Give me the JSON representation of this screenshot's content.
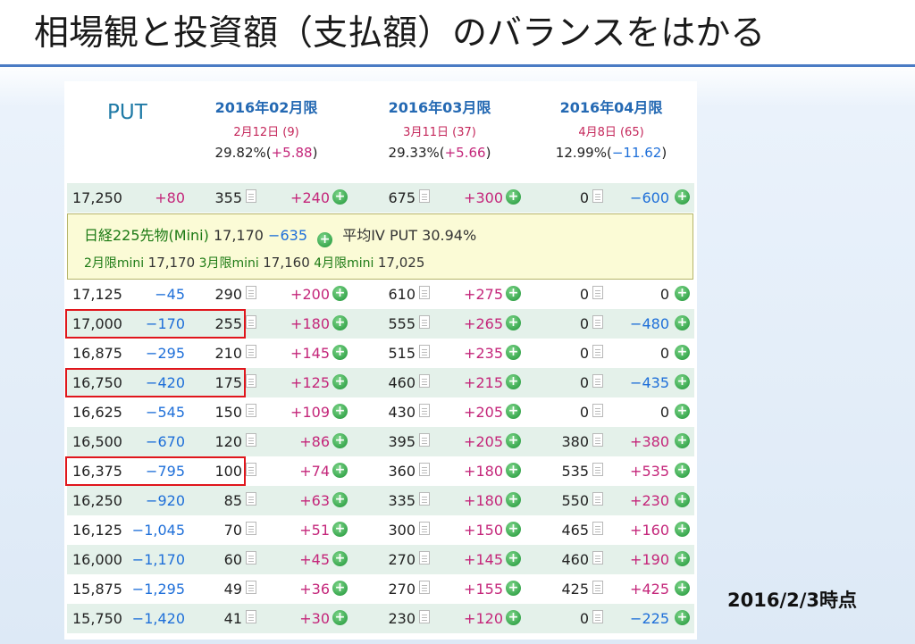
{
  "slide": {
    "title": "相場観と投資額（支払額）のバランスをはかる",
    "timestamp": "2016/2/3時点"
  },
  "table": {
    "header": {
      "put_label": "PUT",
      "months": [
        {
          "contract": "2016年02月限",
          "expiry": "2月12日 (9)",
          "iv": "29.82%",
          "iv_change": "+5.88",
          "iv_change_dir": "up"
        },
        {
          "contract": "2016年03月限",
          "expiry": "3月11日 (37)",
          "iv": "29.33%",
          "iv_change": "+5.66",
          "iv_change_dir": "up"
        },
        {
          "contract": "2016年04月限",
          "expiry": "4月8日 (65)",
          "iv": "12.99%",
          "iv_change": "−11.62",
          "iv_change_dir": "down"
        }
      ]
    },
    "info": {
      "futures_label": "日経225先物(Mini)",
      "futures_price": "17,170",
      "futures_change": "−635",
      "avg_iv_label": "平均IV PUT",
      "avg_iv_value": "30.94%",
      "mini1_label": "2月限mini",
      "mini1_price": "17,170",
      "mini2_label": "3月限mini",
      "mini2_price": "17,160",
      "mini3_label": "4月限mini",
      "mini3_price": "17,025"
    },
    "rows": [
      {
        "strike": "17,250",
        "chg": "+80",
        "chg_dir": "up",
        "p1": "355",
        "c1": "+240",
        "c1_dir": "up",
        "p2": "675",
        "c2": "+300",
        "c2_dir": "up",
        "p3": "0",
        "c3": "−600",
        "c3_dir": "down"
      },
      {
        "strike": "17,125",
        "chg": "−45",
        "chg_dir": "down",
        "p1": "290",
        "c1": "+200",
        "c1_dir": "up",
        "p2": "610",
        "c2": "+275",
        "c2_dir": "up",
        "p3": "0",
        "c3": "0",
        "c3_dir": "zero"
      },
      {
        "strike": "17,000",
        "chg": "−170",
        "chg_dir": "down",
        "p1": "255",
        "c1": "+180",
        "c1_dir": "up",
        "p2": "555",
        "c2": "+265",
        "c2_dir": "up",
        "p3": "0",
        "c3": "−480",
        "c3_dir": "down",
        "highlight": true
      },
      {
        "strike": "16,875",
        "chg": "−295",
        "chg_dir": "down",
        "p1": "210",
        "c1": "+145",
        "c1_dir": "up",
        "p2": "515",
        "c2": "+235",
        "c2_dir": "up",
        "p3": "0",
        "c3": "0",
        "c3_dir": "zero"
      },
      {
        "strike": "16,750",
        "chg": "−420",
        "chg_dir": "down",
        "p1": "175",
        "c1": "+125",
        "c1_dir": "up",
        "p2": "460",
        "c2": "+215",
        "c2_dir": "up",
        "p3": "0",
        "c3": "−435",
        "c3_dir": "down",
        "highlight": true
      },
      {
        "strike": "16,625",
        "chg": "−545",
        "chg_dir": "down",
        "p1": "150",
        "c1": "+109",
        "c1_dir": "up",
        "p2": "430",
        "c2": "+205",
        "c2_dir": "up",
        "p3": "0",
        "c3": "0",
        "c3_dir": "zero"
      },
      {
        "strike": "16,500",
        "chg": "−670",
        "chg_dir": "down",
        "p1": "120",
        "c1": "+86",
        "c1_dir": "up",
        "p2": "395",
        "c2": "+205",
        "c2_dir": "up",
        "p3": "380",
        "c3": "+380",
        "c3_dir": "up"
      },
      {
        "strike": "16,375",
        "chg": "−795",
        "chg_dir": "down",
        "p1": "100",
        "c1": "+74",
        "c1_dir": "up",
        "p2": "360",
        "c2": "+180",
        "c2_dir": "up",
        "p3": "535",
        "c3": "+535",
        "c3_dir": "up",
        "highlight": true
      },
      {
        "strike": "16,250",
        "chg": "−920",
        "chg_dir": "down",
        "p1": "85",
        "c1": "+63",
        "c1_dir": "up",
        "p2": "335",
        "c2": "+180",
        "c2_dir": "up",
        "p3": "550",
        "c3": "+230",
        "c3_dir": "up"
      },
      {
        "strike": "16,125",
        "chg": "−1,045",
        "chg_dir": "down",
        "p1": "70",
        "c1": "+51",
        "c1_dir": "up",
        "p2": "300",
        "c2": "+150",
        "c2_dir": "up",
        "p3": "465",
        "c3": "+160",
        "c3_dir": "up"
      },
      {
        "strike": "16,000",
        "chg": "−1,170",
        "chg_dir": "down",
        "p1": "60",
        "c1": "+45",
        "c1_dir": "up",
        "p2": "270",
        "c2": "+145",
        "c2_dir": "up",
        "p3": "460",
        "c3": "+190",
        "c3_dir": "up"
      },
      {
        "strike": "15,875",
        "chg": "−1,295",
        "chg_dir": "down",
        "p1": "49",
        "c1": "+36",
        "c1_dir": "up",
        "p2": "270",
        "c2": "+155",
        "c2_dir": "up",
        "p3": "425",
        "c3": "+425",
        "c3_dir": "up"
      },
      {
        "strike": "15,750",
        "chg": "−1,420",
        "chg_dir": "down",
        "p1": "41",
        "c1": "+30",
        "c1_dir": "up",
        "p2": "230",
        "c2": "+120",
        "c2_dir": "up",
        "p3": "0",
        "c3": "−225",
        "c3_dir": "down"
      }
    ],
    "icons": {
      "detail": "document-icon",
      "add": "plus-circle-icon"
    },
    "colors": {
      "up": "#c4267a",
      "down": "#1e6fd9",
      "highlight_border": "#e0161c",
      "row_alt": "#e4f1ea",
      "info_bg": "#fbfbd6"
    }
  }
}
